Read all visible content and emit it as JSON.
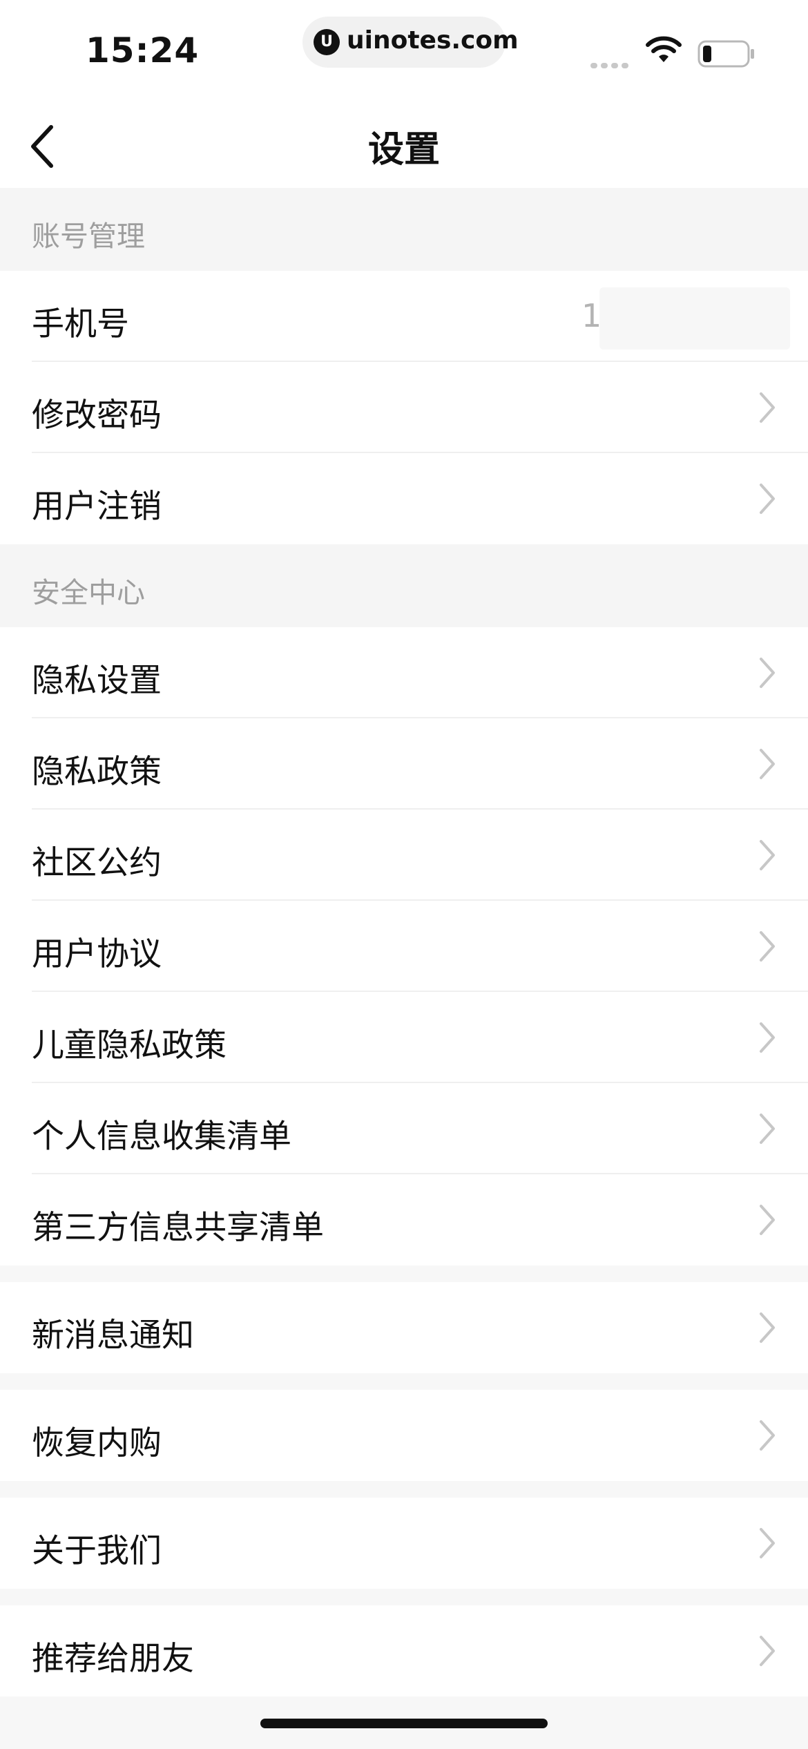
{
  "status_bar": {
    "time": "15:24",
    "url": "uinotes.com",
    "logo_glyph": "U",
    "icons": [
      "signal-icon",
      "wifi-icon",
      "battery-icon"
    ]
  },
  "navbar": {
    "back_icon": "chevron-left-icon",
    "title": "设置"
  },
  "account_section": {
    "header": "账号管理",
    "phone_label": "手机号",
    "phone_value": "1",
    "change_password": "修改密码",
    "deregister": "用户注销"
  },
  "security_section": {
    "header": "安全中心",
    "items": [
      "隐私设置",
      "隐私政策",
      "社区公约",
      "用户协议",
      "儿童隐私政策",
      "个人信息收集清单",
      "第三方信息共享清单"
    ]
  },
  "misc": {
    "notifications": "新消息通知",
    "restore_purchases": "恢复内购",
    "about": "关于我们",
    "recommend": "推荐给朋友"
  },
  "colors": {
    "page_background": "#f7f7f7",
    "row_background": "#ffffff",
    "section_header_text": "#9e9e9e",
    "chevron": "#c7c7c7"
  }
}
